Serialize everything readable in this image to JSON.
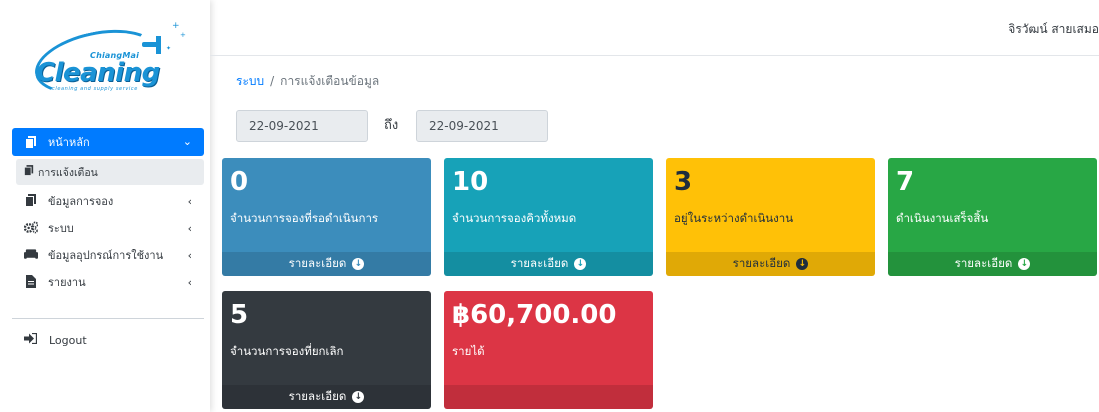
{
  "logo": {
    "top_text": "ChiangMai",
    "main_text": "Cleaning",
    "sub_text": "cleaning and supply service"
  },
  "topbar": {
    "username": "จิรวัฒน์ สายเสมอ"
  },
  "sidebar": {
    "active": {
      "label": "หน้าหลัก",
      "icon": "copy-icon"
    },
    "sub_item": {
      "label": "การแจ้งเตือน",
      "icon": "copy-icon"
    },
    "items": [
      {
        "label": "ข้อมูลการจอง",
        "icon": "copy-icon"
      },
      {
        "label": "ระบบ",
        "icon": "cogs-icon"
      },
      {
        "label": "ข้อมูลอุปกรณ์การใช้งาน",
        "icon": "couch-icon"
      },
      {
        "label": "รายงาน",
        "icon": "file-icon"
      }
    ],
    "logout": {
      "label": "Logout",
      "icon": "sign-out-icon"
    }
  },
  "breadcrumb": {
    "root": "ระบบ",
    "separator": "/",
    "current": "การแจ้งเตือนข้อมูล"
  },
  "filter": {
    "date_from": "22-09-2021",
    "to_label": "ถึง",
    "date_to": "22-09-2021"
  },
  "cards": [
    {
      "value": "0",
      "label": "จำนวนการจองที่รอดำเนินการ",
      "footer": "รายละเอียด",
      "color": "#3c8dbc"
    },
    {
      "value": "10",
      "label": "จำนวนการจองคิวทั้งหมด",
      "footer": "รายละเอียด",
      "color": "#17a2b8"
    },
    {
      "value": "3",
      "label": "อยู่ในระหว่างดำเนินงาน",
      "footer": "รายละเอียด",
      "color": "#ffc107"
    },
    {
      "value": "7",
      "label": "ดำเนินงานเสร็จสิ้น",
      "footer": "รายละเอียด",
      "color": "#28a745"
    },
    {
      "value": "5",
      "label": "จำนวนการจองที่ยกเลิก",
      "footer": "รายละเอียด",
      "color": "#343a40"
    },
    {
      "value": "฿60,700.00",
      "label": "รายได้",
      "footer": "",
      "color": "#dc3545"
    }
  ]
}
